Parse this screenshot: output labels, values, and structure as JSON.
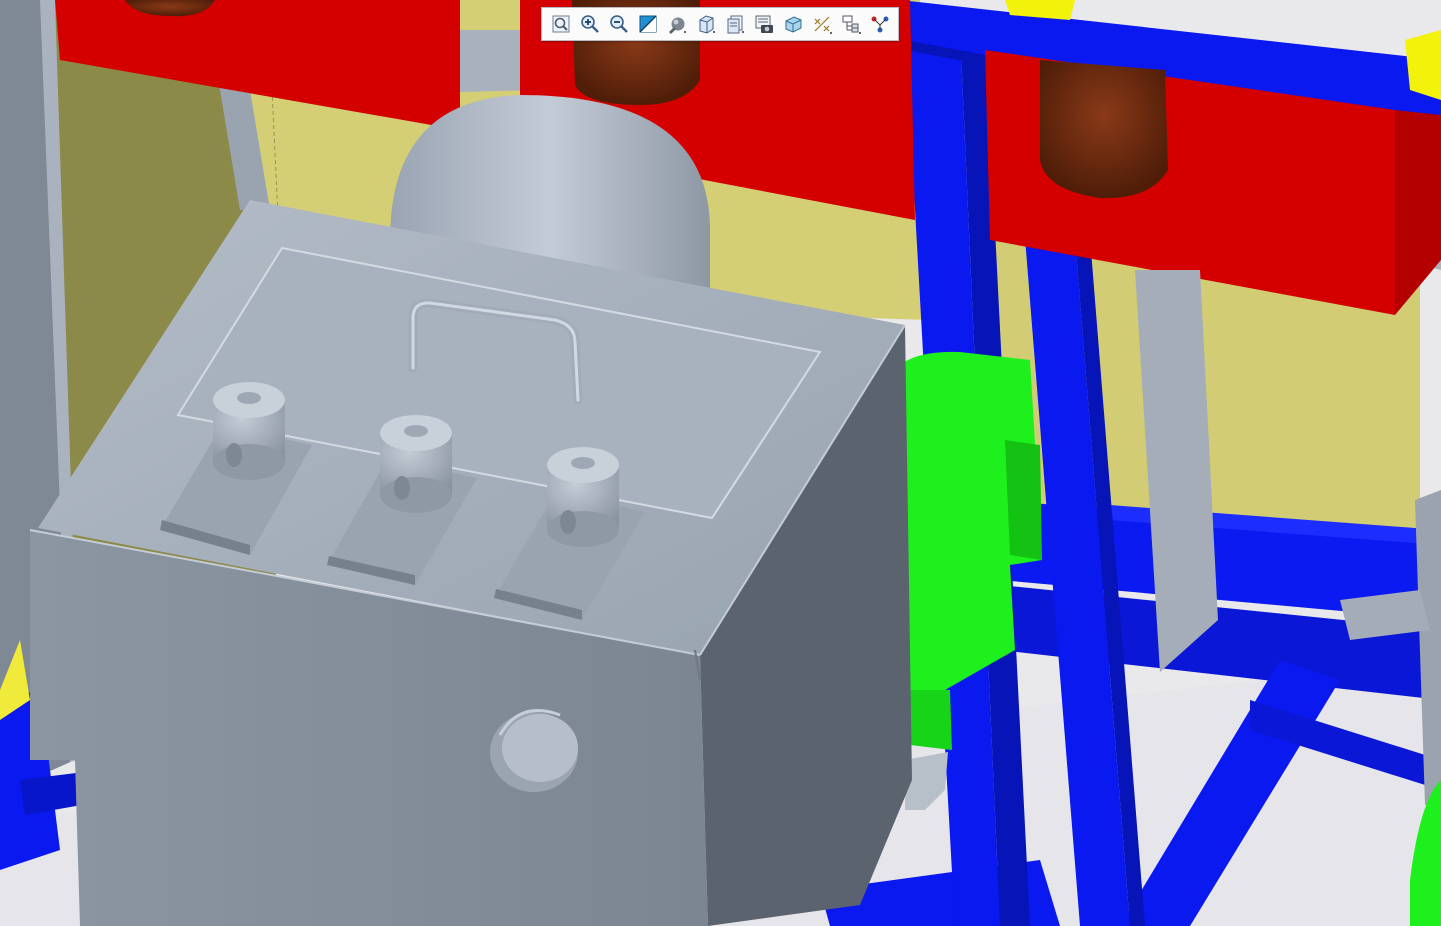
{
  "viewer": {
    "background_color": "#e9e9ec"
  },
  "toolbar": {
    "buttons": [
      {
        "icon": "refit-icon"
      },
      {
        "icon": "zoom-in-icon"
      },
      {
        "icon": "zoom-out-icon"
      },
      {
        "icon": "repaint-icon"
      },
      {
        "icon": "display-style-icon"
      },
      {
        "icon": "saved-orientations-icon"
      },
      {
        "icon": "view-manager-icon"
      },
      {
        "icon": "screenshot-icon"
      },
      {
        "icon": "named-views-icon"
      },
      {
        "icon": "datum-display-icon"
      },
      {
        "icon": "model-tree-icon"
      },
      {
        "icon": "feature-connection-icon"
      }
    ]
  },
  "model": {
    "colors": {
      "frame_blue": "#0a19ef",
      "red_panel": "#d40000",
      "yellow_panel": "#d6cf70",
      "grey_part": "#8f9aa7",
      "green_part": "#1ef01e",
      "bushing_brown": "#6b2a10",
      "yellow_bracket": "#f2f20a"
    }
  }
}
